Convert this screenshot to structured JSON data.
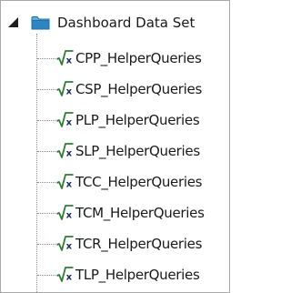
{
  "tree": {
    "root": {
      "label": "Dashboard Data Set",
      "expanded": true,
      "icon": "folder-icon",
      "folder_color": "#2e86c1"
    },
    "items": [
      {
        "label": "CPP_HelperQueries",
        "icon": "sqrt-x-icon"
      },
      {
        "label": "CSP_HelperQueries",
        "icon": "sqrt-x-icon"
      },
      {
        "label": "PLP_HelperQueries",
        "icon": "sqrt-x-icon"
      },
      {
        "label": "SLP_HelperQueries",
        "icon": "sqrt-x-icon"
      },
      {
        "label": "TCC_HelperQueries",
        "icon": "sqrt-x-icon"
      },
      {
        "label": "TCM_HelperQueries",
        "icon": "sqrt-x-icon"
      },
      {
        "label": "TCR_HelperQueries",
        "icon": "sqrt-x-icon"
      },
      {
        "label": "TLP_HelperQueries",
        "icon": "sqrt-x-icon"
      }
    ],
    "colors": {
      "sqrt_stroke": "#2e7d32",
      "x_color": "#1a2a5e"
    }
  }
}
